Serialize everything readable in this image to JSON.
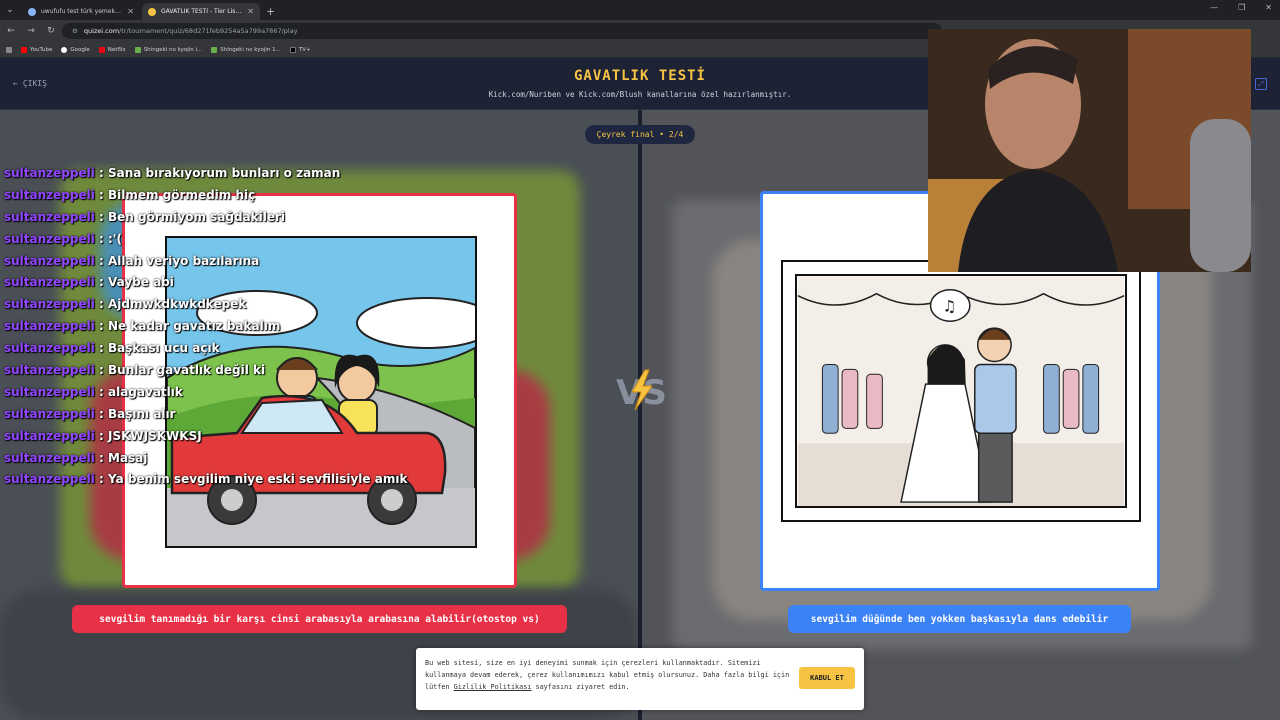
{
  "browser": {
    "tabs": [
      {
        "title": "uwufufu test türk yemekleri - G",
        "active": false
      },
      {
        "title": "GAVATLIK TESTİ - Tier List, Kör",
        "active": true
      }
    ],
    "url_host": "quizei.com",
    "url_path": "/tr/tournament/quiz/68d271feb9254a5a799a7867/play",
    "bookmarks": [
      "YouTube",
      "Google",
      "Netflix",
      "Shingeki no kyojin i...",
      "Shingeki no kyojin 1...",
      "TV+"
    ]
  },
  "header": {
    "exit_label": "ÇIKIŞ",
    "title": "GAVATLIK TESTİ",
    "subtitle": "Kick.com/Nuriben ve Kick.com/Blush kanallarına özel hazırlanmıştır."
  },
  "round": {
    "label": "Çeyrek final • 2/4"
  },
  "left_option": {
    "label": "sevgilim tanımadığı bir karşı cinsi arabasıyla arabasına alabilir(otostop vs)"
  },
  "right_option": {
    "label": "sevgilim düğünde ben yokken başkasıyla dans edebilir"
  },
  "vs_label": "VS",
  "chat": [
    {
      "user": "sultanzeppeli",
      "message": "Sana bırakıyorum bunları o zaman"
    },
    {
      "user": "sultanzeppeli",
      "message": "Bilmem görmedim hiç"
    },
    {
      "user": "sultanzeppeli",
      "message": "Ben görmiyom sağdakileri"
    },
    {
      "user": "sultanzeppeli",
      "message": ":'("
    },
    {
      "user": "sultanzeppeli",
      "message": "Allah veriyo bazılarına"
    },
    {
      "user": "sultanzeppeli",
      "message": "Vaybe abi"
    },
    {
      "user": "sultanzeppeli",
      "message": "Ajdmwkdkwkdkepek"
    },
    {
      "user": "sultanzeppeli",
      "message": "Ne kadar gavatız bakalım"
    },
    {
      "user": "sultanzeppeli",
      "message": "Başkası ucu açık"
    },
    {
      "user": "sultanzeppeli",
      "message": "Bunlar gavatlık değil ki"
    },
    {
      "user": "sultanzeppeli",
      "message": "alagavatlık"
    },
    {
      "user": "sultanzeppeli",
      "message": "Başını alır"
    },
    {
      "user": "sultanzeppeli",
      "message": "JSKWJSKWKSJ"
    },
    {
      "user": "sultanzeppeli",
      "message": "Masaj"
    },
    {
      "user": "sultanzeppeli",
      "message": "Ya benim sevgilim niye eski sevfilisiyle amık"
    }
  ],
  "cookie": {
    "text_before": "Bu web sitesi, size en iyi deneyimi sunmak için çerezleri kullanmaktadır. Sitemizi kullanmaya devam ederek, çerez kullanımımızı kabul etmiş olursunuz. Daha fazla bilgi için lütfen ",
    "link": "Gizlilik Politikası",
    "text_after": " sayfasını ziyaret edin.",
    "accept": "KABUL ET"
  },
  "colors": {
    "accent_gold": "#f6c343",
    "left_red": "#e83047",
    "right_blue": "#3b82f6",
    "chat_user": "#9146ff"
  }
}
